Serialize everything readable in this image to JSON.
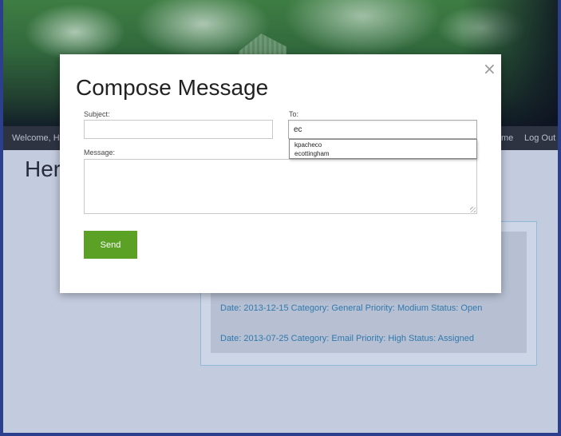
{
  "navbar": {
    "welcome": "Welcome, H",
    "home": "me",
    "logout": "Log Out"
  },
  "page": {
    "heading": "Her"
  },
  "tickets": [
    {
      "text": "Date: 2013-12-15 Category: General Priority: Modium Status: Open"
    },
    {
      "text": "Date: 2013-07-25 Category: Email Priority: High Status: Assigned"
    }
  ],
  "modal": {
    "title": "Compose Message",
    "close": "×",
    "subject_label": "Subject:",
    "subject_value": "",
    "to_label": "To:",
    "to_value": "ec",
    "message_label": "Message:",
    "message_value": "",
    "autocomplete": [
      "kpacheco",
      "ecottingham"
    ],
    "send_label": "Send"
  },
  "colors": {
    "send_button": "#5aa125",
    "ticket_link": "#2e84b5",
    "navbar": "#2b2b2b"
  }
}
